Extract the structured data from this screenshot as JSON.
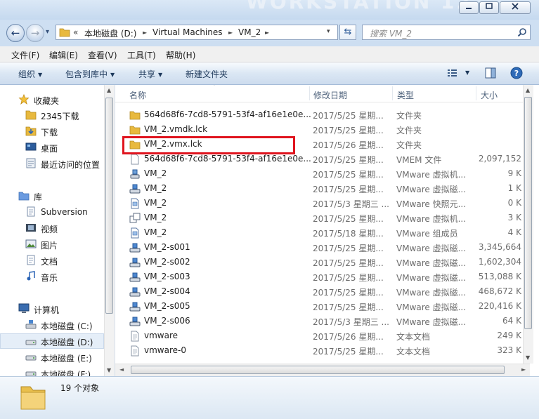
{
  "window": {
    "bg_title": "WORKSTATION 12"
  },
  "nav": {
    "back_arrow": "←",
    "forward_arrow": "→",
    "dropdown": "▾",
    "breadcrumb_overflow": "«",
    "path": [
      "本地磁盘 (D:)",
      "Virtual Machines",
      "VM_2"
    ],
    "sep": "►"
  },
  "search": {
    "placeholder": "搜索 VM_2"
  },
  "menu": [
    "文件(F)",
    "编辑(E)",
    "查看(V)",
    "工具(T)",
    "帮助(H)"
  ],
  "commands": [
    {
      "label": "组织",
      "dropdown": true
    },
    {
      "label": "包含到库中",
      "dropdown": true
    },
    {
      "label": "共享",
      "dropdown": true
    },
    {
      "label": "新建文件夹",
      "dropdown": false
    }
  ],
  "navpane": {
    "favorites": {
      "label": "收藏夹",
      "items": [
        "2345下载",
        "下载",
        "桌面",
        "最近访问的位置"
      ]
    },
    "libraries": {
      "label": "库",
      "items": [
        "Subversion",
        "视频",
        "图片",
        "文档",
        "音乐"
      ]
    },
    "computer": {
      "label": "计算机",
      "items": [
        "本地磁盘 (C:)",
        "本地磁盘 (D:)",
        "本地磁盘 (E:)",
        "本地磁盘 (F:)"
      ]
    }
  },
  "columns": {
    "name": "名称",
    "date": "修改日期",
    "type": "类型",
    "size": "大小"
  },
  "files": [
    {
      "name": "564d68f6-7cd8-5791-53f4-af16e1e0e...",
      "date": "2017/5/25 星期...",
      "type": "文件夹",
      "size": "",
      "icon": "folder"
    },
    {
      "name": "VM_2.vmdk.lck",
      "date": "2017/5/25 星期...",
      "type": "文件夹",
      "size": "",
      "icon": "folder"
    },
    {
      "name": "VM_2.vmx.lck",
      "date": "2017/5/26 星期...",
      "type": "文件夹",
      "size": "",
      "icon": "folder"
    },
    {
      "name": "564d68f6-7cd8-5791-53f4-af16e1e0e...",
      "date": "2017/5/25 星期...",
      "type": "VMEM 文件",
      "size": "2,097,152",
      "icon": "blank"
    },
    {
      "name": "VM_2",
      "date": "2017/5/25 星期...",
      "type": "VMware 虚拟机...",
      "size": "9 K",
      "icon": "vmx"
    },
    {
      "name": "VM_2",
      "date": "2017/5/25 星期...",
      "type": "VMware 虚拟磁...",
      "size": "1 K",
      "icon": "disk"
    },
    {
      "name": "VM_2",
      "date": "2017/5/3 星期三 ...",
      "type": "VMware 快照元...",
      "size": "0 K",
      "icon": "doc"
    },
    {
      "name": "VM_2",
      "date": "2017/5/25 星期...",
      "type": "VMware 虚拟机...",
      "size": "3 K",
      "icon": "snap"
    },
    {
      "name": "VM_2",
      "date": "2017/5/18 星期...",
      "type": "VMware 组成员",
      "size": "4 K",
      "icon": "doc"
    },
    {
      "name": "VM_2-s001",
      "date": "2017/5/25 星期...",
      "type": "VMware 虚拟磁...",
      "size": "3,345,664",
      "icon": "disk"
    },
    {
      "name": "VM_2-s002",
      "date": "2017/5/25 星期...",
      "type": "VMware 虚拟磁...",
      "size": "1,602,304",
      "icon": "disk"
    },
    {
      "name": "VM_2-s003",
      "date": "2017/5/25 星期...",
      "type": "VMware 虚拟磁...",
      "size": "513,088 K",
      "icon": "disk"
    },
    {
      "name": "VM_2-s004",
      "date": "2017/5/25 星期...",
      "type": "VMware 虚拟磁...",
      "size": "468,672 K",
      "icon": "disk"
    },
    {
      "name": "VM_2-s005",
      "date": "2017/5/25 星期...",
      "type": "VMware 虚拟磁...",
      "size": "220,416 K",
      "icon": "disk"
    },
    {
      "name": "VM_2-s006",
      "date": "2017/5/3 星期三 ...",
      "type": "VMware 虚拟磁...",
      "size": "64 K",
      "icon": "disk"
    },
    {
      "name": "vmware",
      "date": "2017/5/26 星期...",
      "type": "文本文档",
      "size": "249 K",
      "icon": "text"
    },
    {
      "name": "vmware-0",
      "date": "2017/5/25 星期...",
      "type": "文本文档",
      "size": "323 K",
      "icon": "text"
    }
  ],
  "status": {
    "count": "19 个对象"
  },
  "colors": {
    "highlight": "#e0141e",
    "accent": "#1e395b"
  }
}
